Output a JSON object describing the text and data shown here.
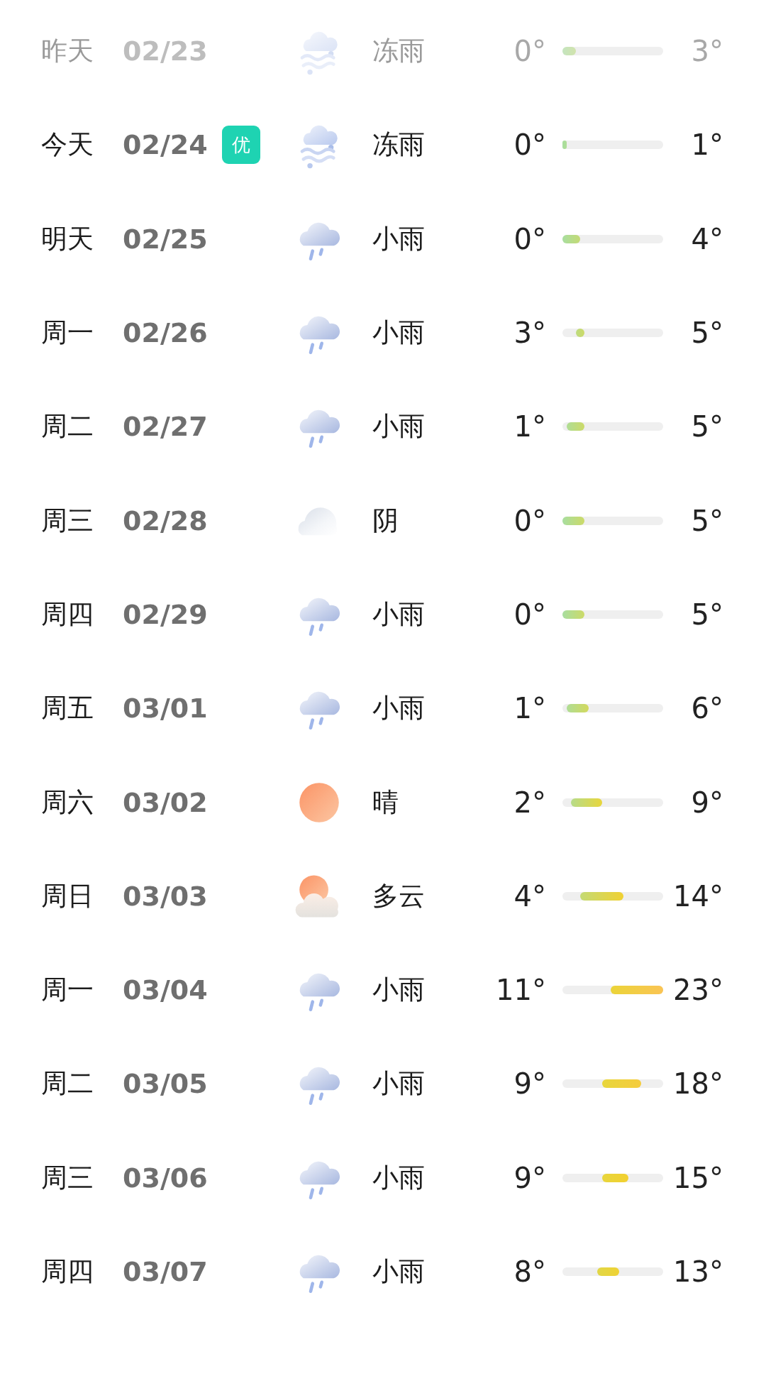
{
  "forecast": [
    {
      "day": "昨天",
      "date": "02/23",
      "past": true,
      "kind": "sleet",
      "condition": "冻雨",
      "low": "0°",
      "high": "3°"
    },
    {
      "day": "今天",
      "date": "02/24",
      "past": false,
      "badge": "优",
      "kind": "sleet",
      "condition": "冻雨",
      "low": "0°",
      "high": "1°"
    },
    {
      "day": "明天",
      "date": "02/25",
      "past": false,
      "kind": "rain",
      "condition": "小雨",
      "low": "0°",
      "high": "4°"
    },
    {
      "day": "周一",
      "date": "02/26",
      "past": false,
      "kind": "rain",
      "condition": "小雨",
      "low": "3°",
      "high": "5°"
    },
    {
      "day": "周二",
      "date": "02/27",
      "past": false,
      "kind": "rain",
      "condition": "小雨",
      "low": "1°",
      "high": "5°"
    },
    {
      "day": "周三",
      "date": "02/28",
      "past": false,
      "kind": "cloud",
      "condition": "阴",
      "low": "0°",
      "high": "5°"
    },
    {
      "day": "周四",
      "date": "02/29",
      "past": false,
      "kind": "rain",
      "condition": "小雨",
      "low": "0°",
      "high": "5°"
    },
    {
      "day": "周五",
      "date": "03/01",
      "past": false,
      "kind": "rain",
      "condition": "小雨",
      "low": "1°",
      "high": "6°"
    },
    {
      "day": "周六",
      "date": "03/02",
      "past": false,
      "kind": "sun",
      "condition": "晴",
      "low": "2°",
      "high": "9°"
    },
    {
      "day": "周日",
      "date": "03/03",
      "past": false,
      "kind": "suncloud",
      "condition": "多云",
      "low": "4°",
      "high": "14°"
    },
    {
      "day": "周一",
      "date": "03/04",
      "past": false,
      "kind": "rain",
      "condition": "小雨",
      "low": "11°",
      "high": "23°"
    },
    {
      "day": "周二",
      "date": "03/05",
      "past": false,
      "kind": "rain",
      "condition": "小雨",
      "low": "9°",
      "high": "18°"
    },
    {
      "day": "周三",
      "date": "03/06",
      "past": false,
      "kind": "rain",
      "condition": "小雨",
      "low": "9°",
      "high": "15°"
    },
    {
      "day": "周四",
      "date": "03/07",
      "past": false,
      "kind": "rain",
      "condition": "小雨",
      "low": "8°",
      "high": "13°"
    }
  ]
}
